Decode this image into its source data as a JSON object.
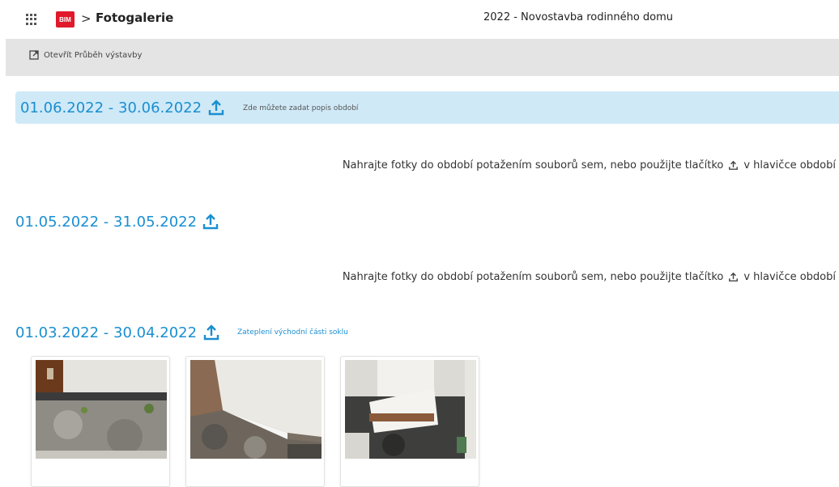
{
  "header": {
    "logo_text": "BIM",
    "separator": ">",
    "title": "Fotogalerie",
    "project": "2022 - Novostavba rodinného domu"
  },
  "toolbar": {
    "open_button_label": "Otevřít Průběh výstavby",
    "open_button_icon": "open-external-icon"
  },
  "periods": [
    {
      "date": "01.06.2022 - 30.06.2022",
      "description": "Zde můžete zadat popis období",
      "active": true
    },
    {
      "date": "01.05.2022 - 31.05.2022",
      "description": "",
      "active": false
    },
    {
      "date": "01.03.2022 - 30.04.2022",
      "description": "Zateplení východní části soklu",
      "active": false
    }
  ],
  "dropzone": {
    "text_before": "Nahrajte fotky do období potažením souborů sem, nebo použijte tlačítko",
    "text_after": "v hlavičce období"
  },
  "photos": [
    {
      "name": "photo-1",
      "alt": "Štěrk u soklu domu"
    },
    {
      "name": "photo-2",
      "alt": "Sokl domu se štěrkem"
    },
    {
      "name": "photo-3",
      "alt": "Zateplení soklu"
    }
  ],
  "colors": {
    "accent": "#1a8fd0",
    "active_period_bg": "#cfe9f7",
    "toolbar_bg": "#e4e4e4",
    "logo_red": "#e0192b"
  }
}
